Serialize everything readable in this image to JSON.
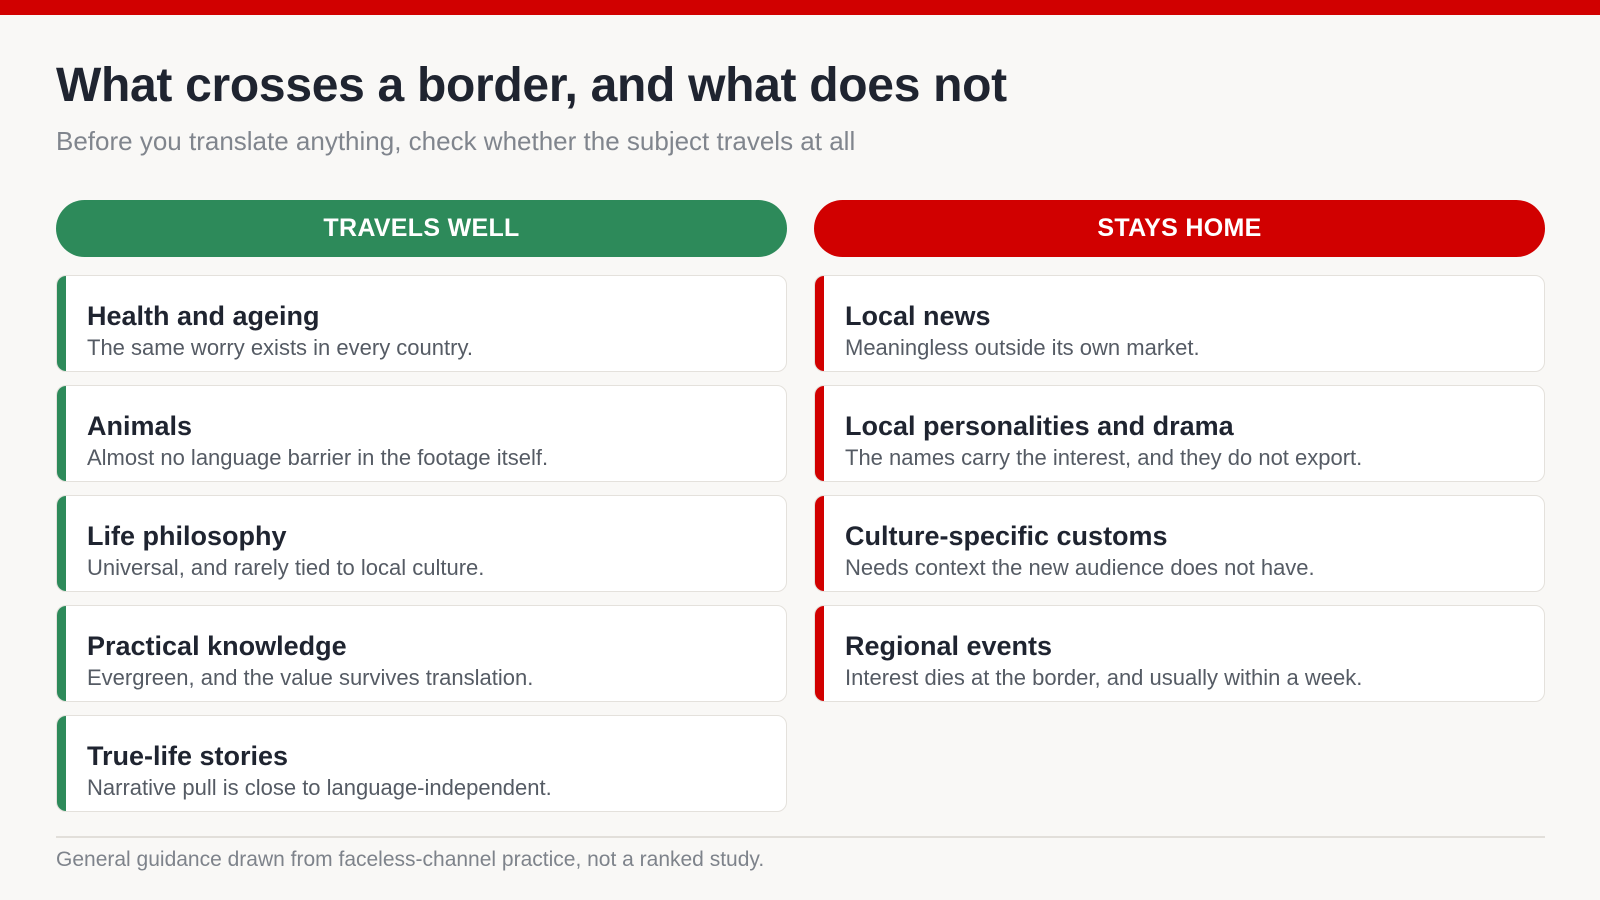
{
  "colors": {
    "accent_red": "#d10000",
    "accent_green": "#2d8a5a",
    "background": "#f9f8f6"
  },
  "title": "What crosses a border, and what does not",
  "subtitle": "Before you translate anything, check whether the subject travels at all",
  "travels_well": {
    "header": "TRAVELS WELL",
    "items": [
      {
        "title": "Health and ageing",
        "desc": "The same worry exists in every country."
      },
      {
        "title": "Animals",
        "desc": "Almost no language barrier in the footage itself."
      },
      {
        "title": "Life philosophy",
        "desc": "Universal, and rarely tied to local culture."
      },
      {
        "title": "Practical knowledge",
        "desc": "Evergreen, and the value survives translation."
      },
      {
        "title": "True-life stories",
        "desc": "Narrative pull is close to language-independent."
      }
    ]
  },
  "stays_home": {
    "header": "STAYS HOME",
    "items": [
      {
        "title": "Local news",
        "desc": "Meaningless outside its own market."
      },
      {
        "title": "Local personalities and drama",
        "desc": "The names carry the interest, and they do not export."
      },
      {
        "title": "Culture-specific customs",
        "desc": "Needs context the new audience does not have."
      },
      {
        "title": "Regional events",
        "desc": "Interest dies at the border, and usually within a week."
      }
    ]
  },
  "footnote": "General guidance drawn from faceless-channel practice, not a ranked study."
}
